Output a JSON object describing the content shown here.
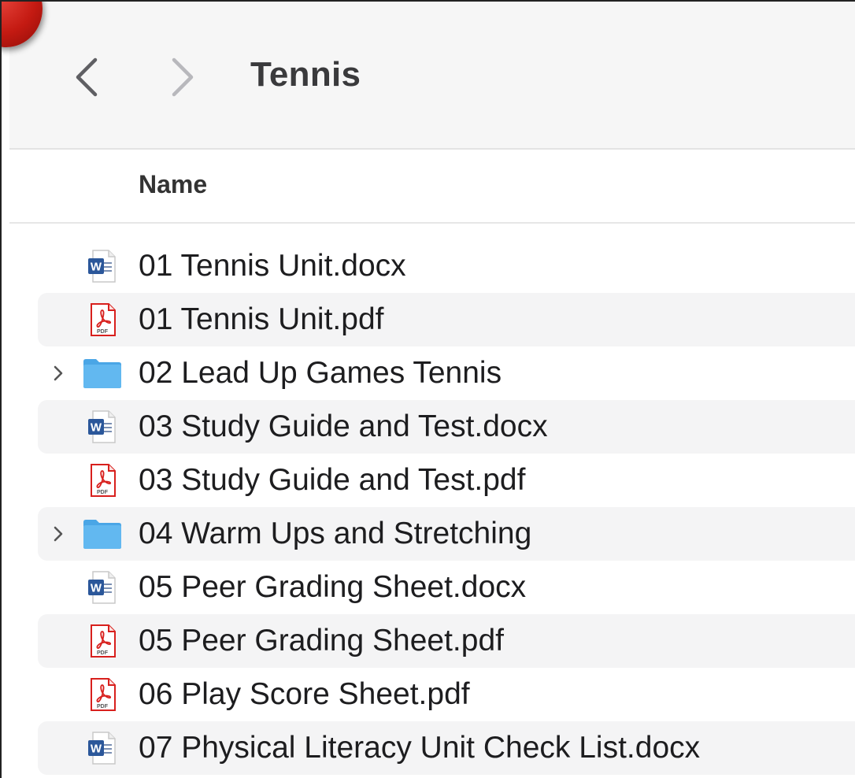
{
  "window": {
    "title": "Tennis",
    "back_icon": "chevron-left-icon",
    "forward_icon": "chevron-right-icon"
  },
  "columns": {
    "name": "Name"
  },
  "files": [
    {
      "name": "01 Tennis Unit.docx",
      "kind": "word",
      "icon": "word-document-icon",
      "expandable": false
    },
    {
      "name": "01 Tennis Unit.pdf",
      "kind": "pdf",
      "icon": "pdf-document-icon",
      "expandable": false
    },
    {
      "name": "02 Lead Up Games Tennis",
      "kind": "folder",
      "icon": "folder-icon",
      "expandable": true
    },
    {
      "name": "03 Study Guide and Test.docx",
      "kind": "word",
      "icon": "word-document-icon",
      "expandable": false
    },
    {
      "name": "03 Study Guide and Test.pdf",
      "kind": "pdf",
      "icon": "pdf-document-icon",
      "expandable": false
    },
    {
      "name": "04 Warm Ups and Stretching",
      "kind": "folder",
      "icon": "folder-icon",
      "expandable": true
    },
    {
      "name": "05 Peer Grading Sheet.docx",
      "kind": "word",
      "icon": "word-document-icon",
      "expandable": false
    },
    {
      "name": "05 Peer Grading Sheet.pdf",
      "kind": "pdf",
      "icon": "pdf-document-icon",
      "expandable": false
    },
    {
      "name": "06 Play Score Sheet.pdf",
      "kind": "pdf",
      "icon": "pdf-document-icon",
      "expandable": false
    },
    {
      "name": "07 Physical Literacy Unit Check List.docx",
      "kind": "word",
      "icon": "word-document-icon",
      "expandable": false
    }
  ],
  "icon_labels": {
    "word": "W",
    "pdf": "PDF"
  },
  "colors": {
    "word_blue": "#2b579a",
    "pdf_red": "#d8201d",
    "folder_blue": "#62b8f0",
    "row_stripe": "#f4f4f5",
    "toolbar_bg": "#f6f6f6"
  }
}
